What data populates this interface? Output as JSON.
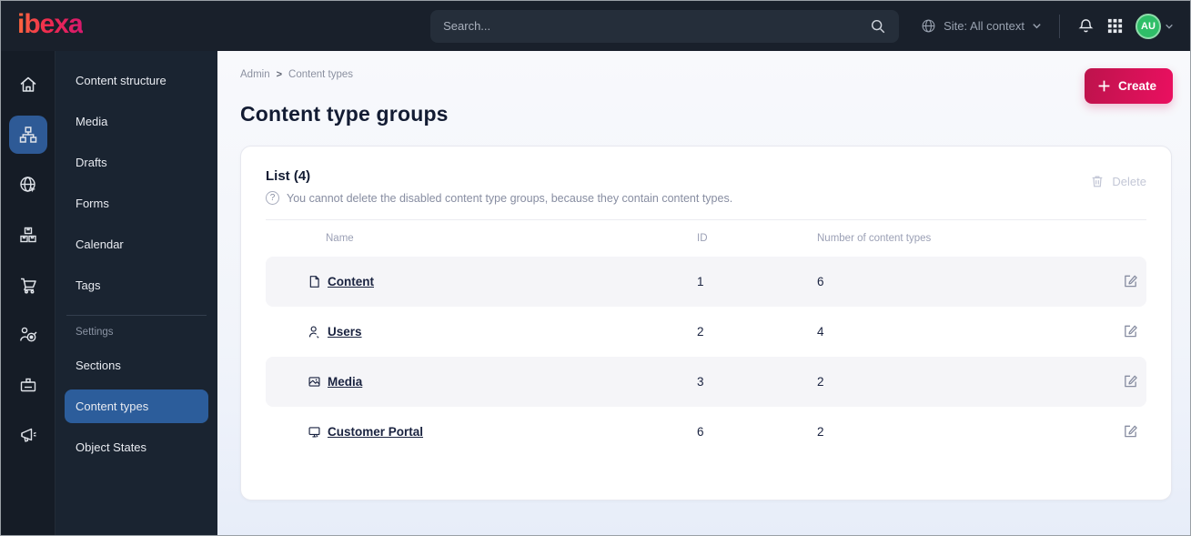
{
  "topbar": {
    "logo_text": "ibexa",
    "search_placeholder": "Search...",
    "site_context_label": "Site: All context",
    "avatar_initials": "AU"
  },
  "sidebar": {
    "rail_items": [
      {
        "icon": "home-icon",
        "active": false
      },
      {
        "icon": "content-structure-icon",
        "active": true
      },
      {
        "icon": "site-globe-icon",
        "active": false
      },
      {
        "icon": "products-icon",
        "active": false
      },
      {
        "icon": "cart-icon",
        "active": false
      },
      {
        "icon": "audience-target-icon",
        "active": false
      },
      {
        "icon": "badge-icon",
        "active": false
      },
      {
        "icon": "megaphone-icon",
        "active": false
      }
    ],
    "menu": {
      "items": [
        {
          "label": "Content structure"
        },
        {
          "label": "Media"
        },
        {
          "label": "Drafts"
        },
        {
          "label": "Forms"
        },
        {
          "label": "Calendar"
        },
        {
          "label": "Tags"
        }
      ],
      "settings_label": "Settings",
      "settings_items": [
        {
          "label": "Sections",
          "active": false
        },
        {
          "label": "Content types",
          "active": true
        },
        {
          "label": "Object States",
          "active": false
        }
      ]
    }
  },
  "main": {
    "breadcrumb": [
      {
        "label": "Admin"
      },
      {
        "label": "Content types"
      }
    ],
    "create_button_label": "Create",
    "page_title": "Content type groups",
    "card": {
      "list_title": "List (4)",
      "info_text": "You cannot delete the disabled content type groups, because they contain content types.",
      "delete_button_label": "Delete",
      "table": {
        "columns": {
          "name": "Name",
          "id": "ID",
          "count": "Number of content types"
        },
        "rows": [
          {
            "icon": "file-icon",
            "name": "Content",
            "id": "1",
            "count": "6"
          },
          {
            "icon": "user-icon",
            "name": "Users",
            "id": "2",
            "count": "4"
          },
          {
            "icon": "image-icon",
            "name": "Media",
            "id": "3",
            "count": "2"
          },
          {
            "icon": "monitor-icon",
            "name": "Customer Portal",
            "id": "6",
            "count": "2"
          }
        ]
      }
    }
  },
  "colors": {
    "topbar_bg": "#19202b",
    "rail_bg": "#151c26",
    "menu_bg": "#1a2431",
    "active_blue": "#2e5a96",
    "brand_gradient_start": "#bd134c",
    "brand_gradient_end": "#ea1060",
    "avatar_green": "#2fbe68",
    "text_dark": "#1a2340",
    "text_muted": "#878da1",
    "row_alt_bg": "#f5f5f8"
  }
}
